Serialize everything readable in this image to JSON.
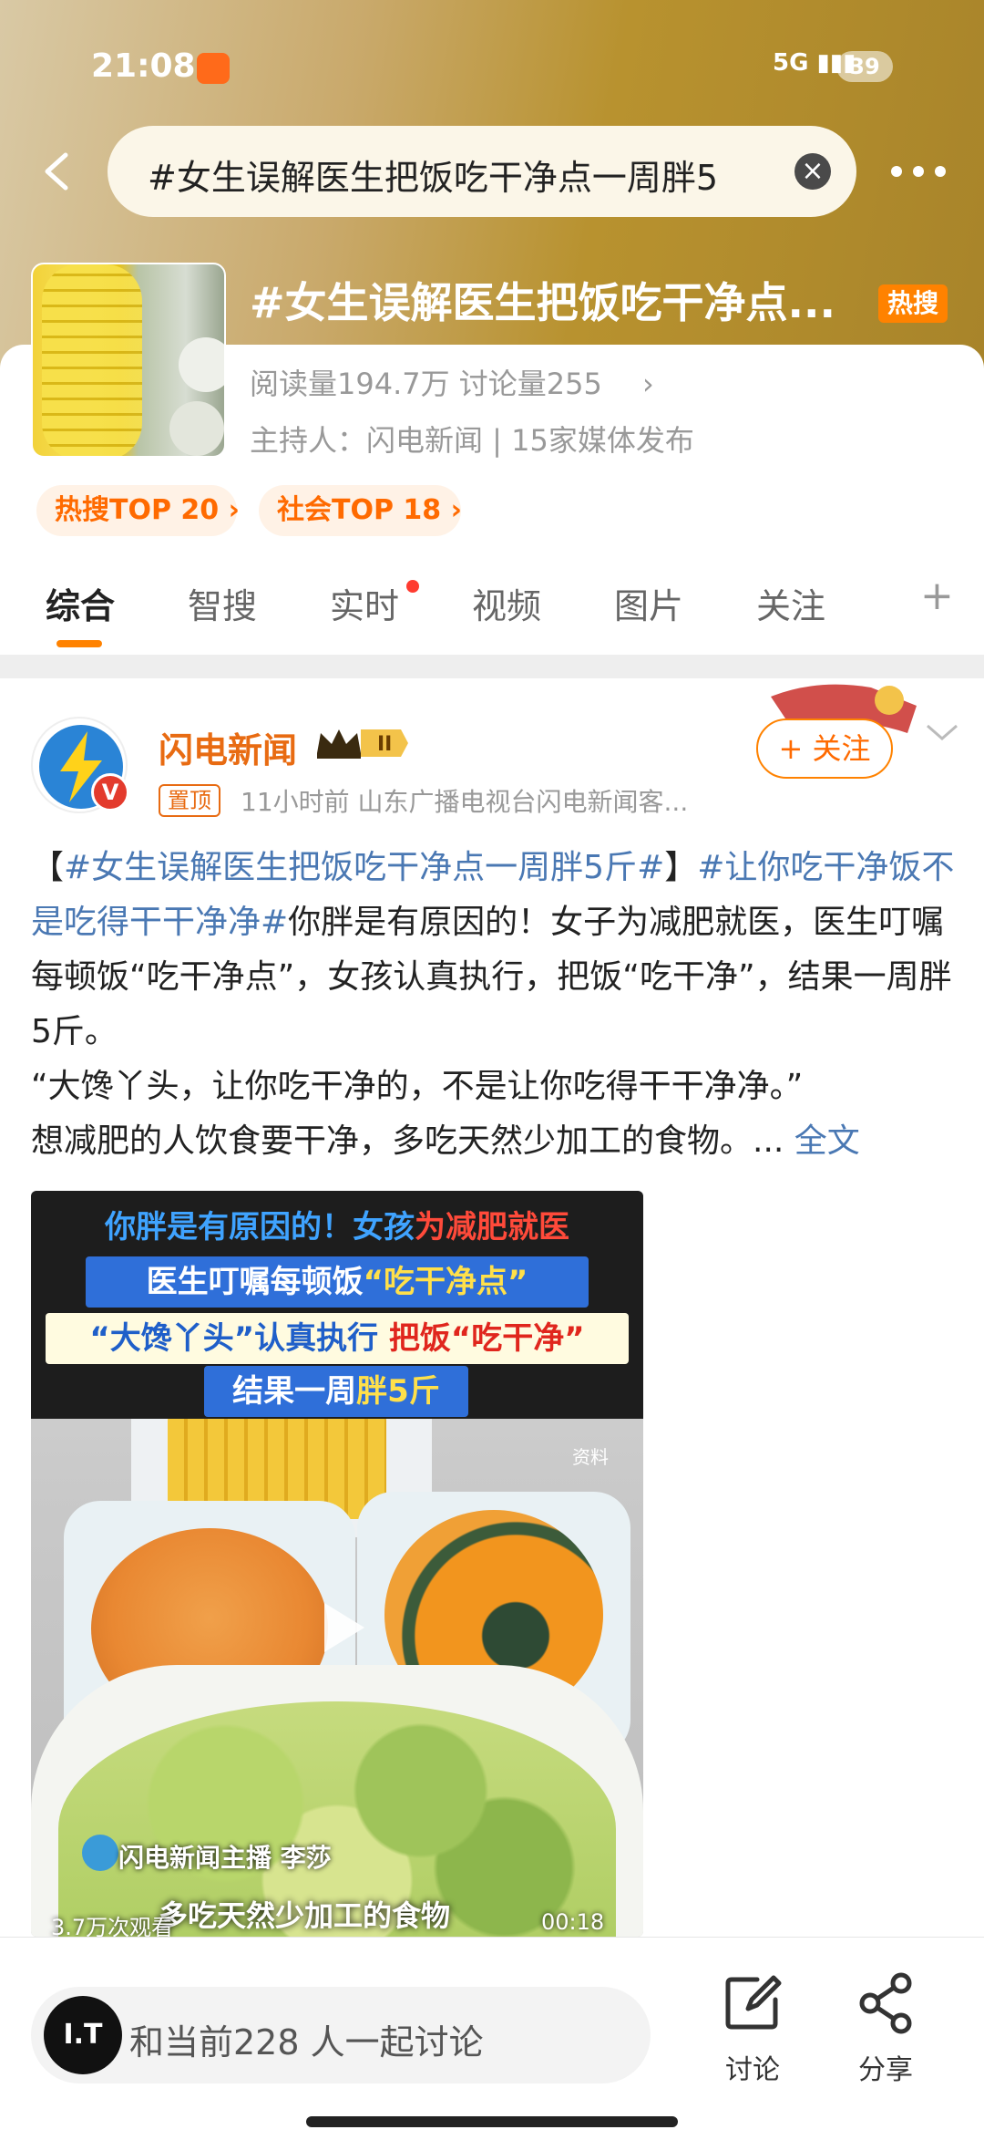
{
  "status_bar": {
    "time": "21:08",
    "network": "5G",
    "battery": "39"
  },
  "search": {
    "query": "#女生误解医生把饭吃干净点一周胖5"
  },
  "topic": {
    "title": "#女生误解医生把饭吃干净点...",
    "badge": "热搜",
    "stats": "阅读量194.7万  讨论量255",
    "host": "主持人：闪电新闻 | 15家媒体发布",
    "rank_pills": [
      "热搜TOP 20 ›",
      "社会TOP 18 ›"
    ]
  },
  "tabs": [
    "综合",
    "智搜",
    "实时",
    "视频",
    "图片",
    "关注",
    "+"
  ],
  "post": {
    "author": "闪电新闻",
    "level_badge": "II",
    "pin_label": "置顶",
    "meta": "11小时前   山东广播电视台闪电新闻客...",
    "follow_label": "+ 关注",
    "text": {
      "open": "【",
      "tag1": "#女生误解医生把饭吃干净点一周胖5斤#",
      "close": "】",
      "tag2": "#让你吃干净饭不是吃得干干净净#",
      "body1": "你胖是有原因的！女子为减肥就医，医生叮嘱每顿饭“吃干净点”，女孩认真执行，把饭“吃干净”，结果一周胖5斤。",
      "body2": "“大馋丫头，让你吃干净的，不是让你吃得干干净净。”",
      "body3": "想减肥的人饮食要干净，多吃天然少加工的食物。... ",
      "expand": "全文"
    },
    "video": {
      "line1_a": "你胖是有原因的！女孩",
      "line1_b": "为减肥就医",
      "line2_a": "医生叮嘱每顿饭",
      "line2_b": "“吃干净点”",
      "line3_a": "“大馋丫头”认真执行 ",
      "line3_b": "把饭“吃干净”",
      "line4_a": "结果一周",
      "line4_b": "胖5斤",
      "source_tag": "资料",
      "anchor": "闪电新闻主播 李莎",
      "caption": "多吃天然少加工的食物",
      "plays": "3.7万次观看",
      "duration": "00:18"
    }
  },
  "bottom_bar": {
    "avatar_text": "I.T",
    "discuss_placeholder": "和当前228 人一起讨论",
    "actions": [
      "讨论",
      "分享"
    ]
  }
}
